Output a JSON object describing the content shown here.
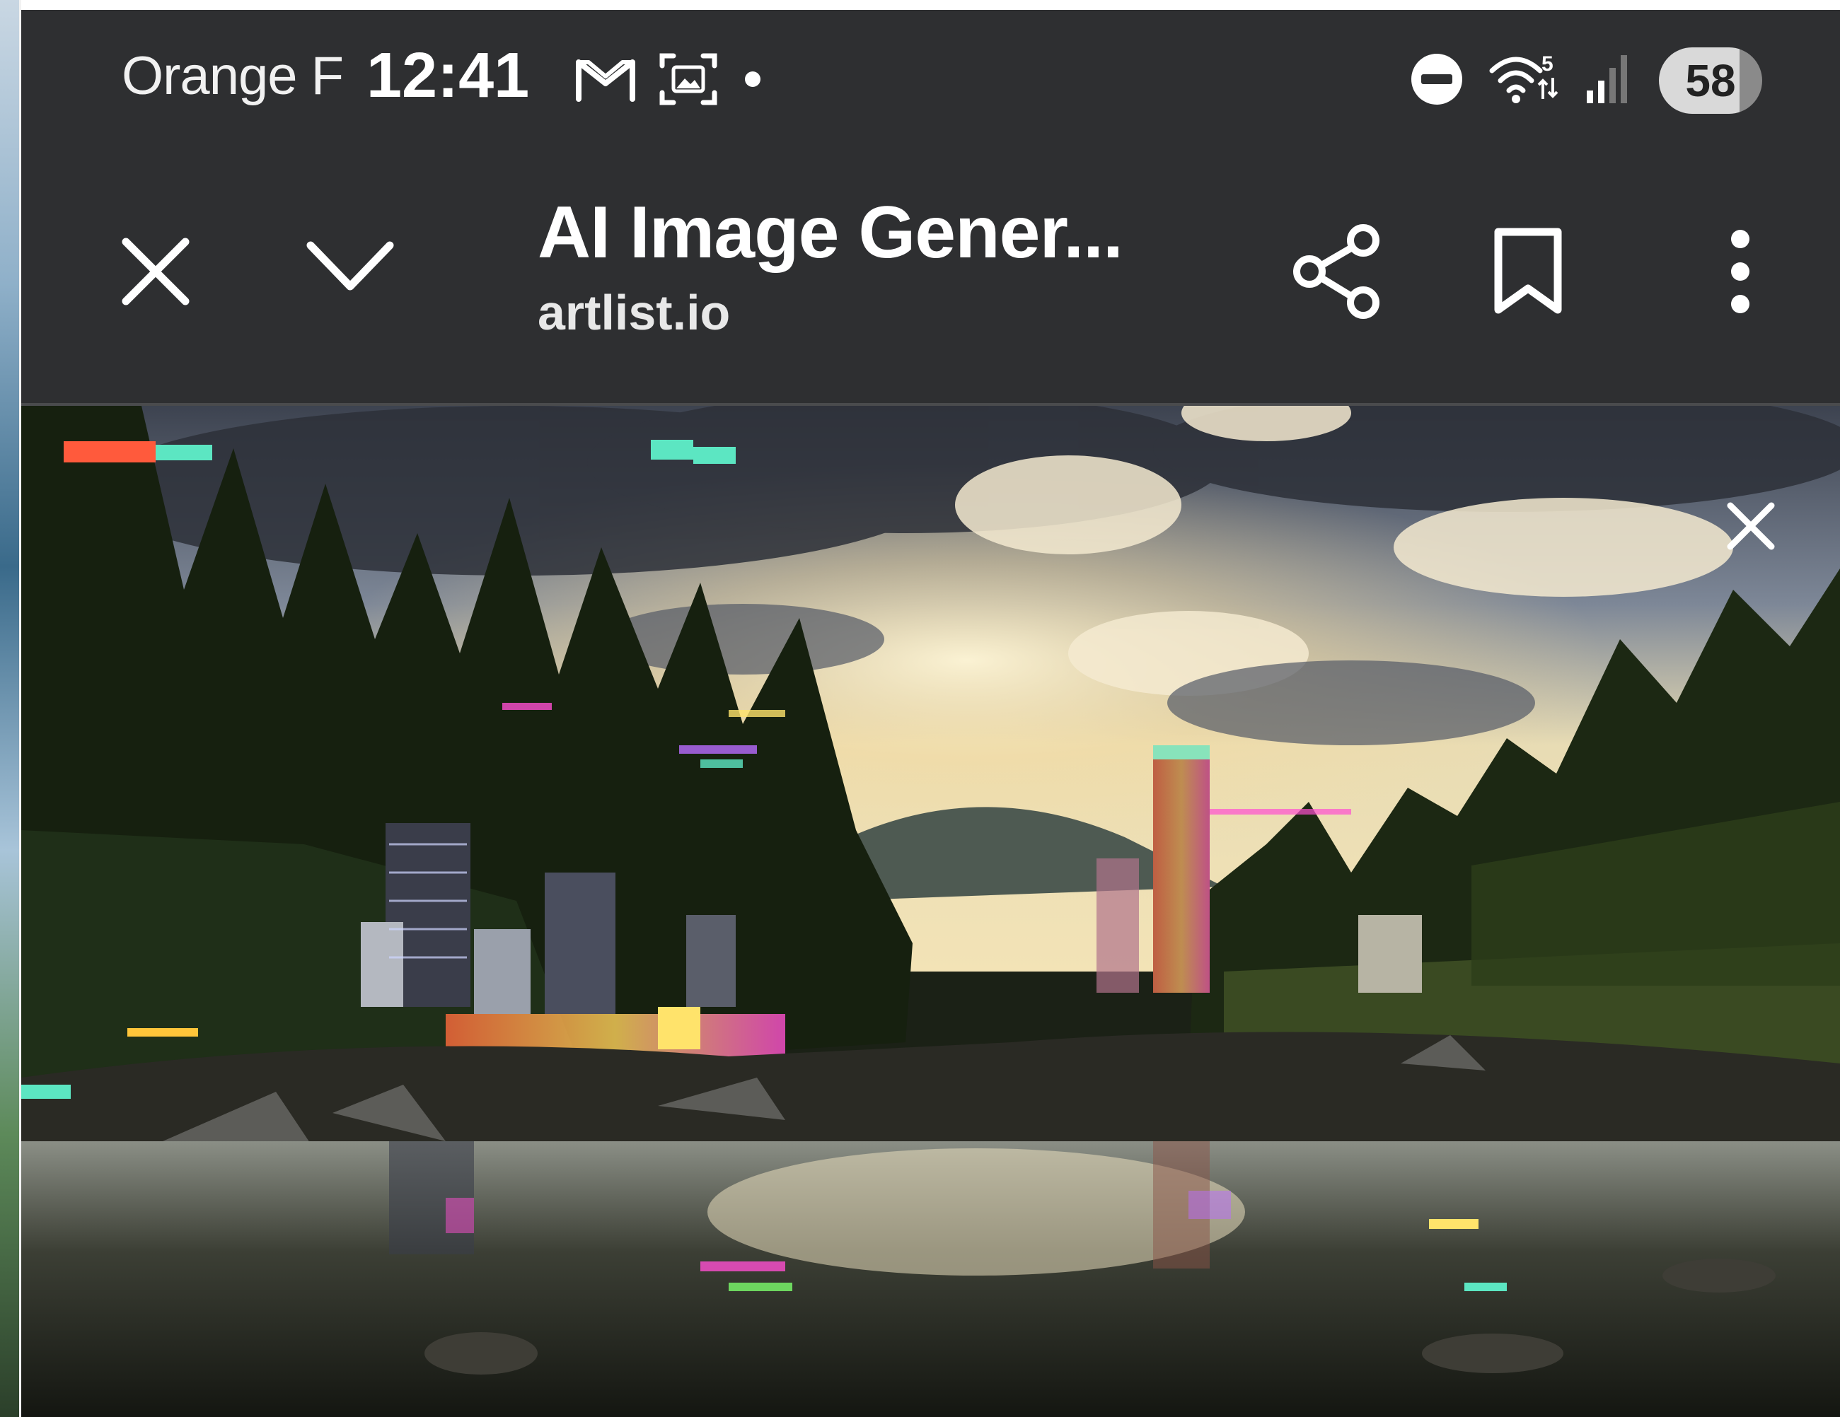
{
  "status_bar": {
    "carrier": "Orange F",
    "time": "12:41",
    "battery_level": "58",
    "notification_icons": [
      "gmail-icon",
      "screenshot-icon",
      "dot-indicator-icon"
    ],
    "system_icons": [
      "do-not-disturb-icon",
      "wifi-5-icon",
      "cell-signal-icon"
    ]
  },
  "toolbar": {
    "title": "AI Image Gener...",
    "url": "artlist.io",
    "buttons": [
      "close-icon",
      "chevron-down-icon",
      "share-icon",
      "bookmark-icon",
      "more-vert-icon"
    ]
  },
  "content": {
    "image_subject": "glitch-art forest river landscape with city buildings",
    "overlay_close": "close-icon"
  },
  "colors": {
    "bar_background": "#2e2f31",
    "text_primary": "#ffffff",
    "divider": "#4a4b4d"
  }
}
